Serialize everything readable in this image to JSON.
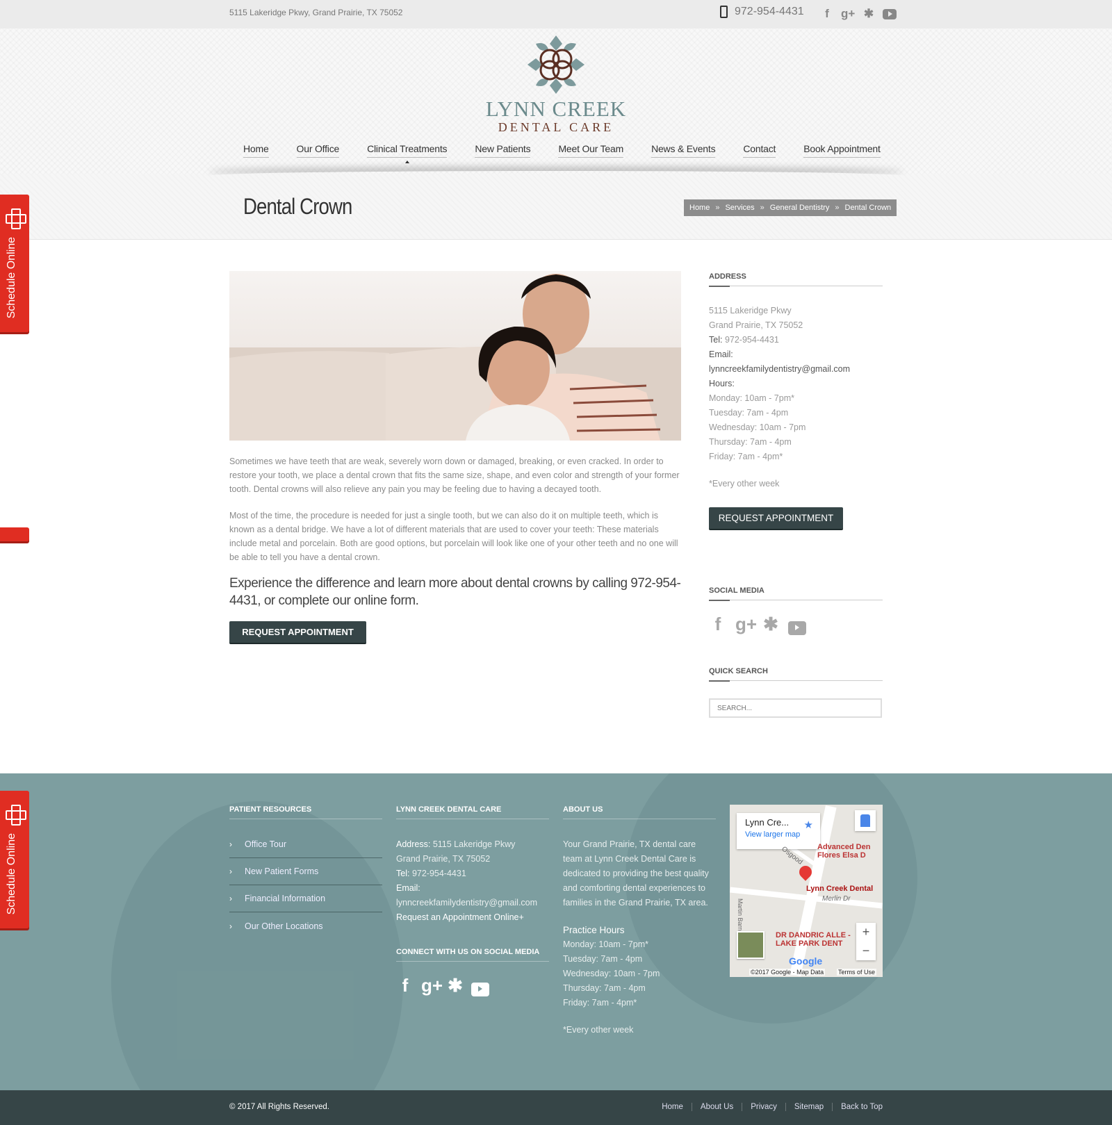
{
  "topbar": {
    "address": "5115 Lakeridge Pkwy, Grand Prairie, TX 75052",
    "phone": "972-954-4431",
    "social": [
      "facebook-icon",
      "google-plus-icon",
      "yelp-icon",
      "youtube-icon"
    ]
  },
  "logo": {
    "line1": "LYNN CREEK",
    "line2": "DENTAL CARE"
  },
  "nav": {
    "items": [
      "Home",
      "Our Office",
      "Clinical Treatments",
      "New Patients",
      "Meet Our Team",
      "News & Events",
      "Contact",
      "Book Appointment"
    ],
    "active": "Clinical Treatments"
  },
  "page": {
    "title": "Dental Crown",
    "breadcrumb": [
      "Home",
      "Services",
      "General Dentistry",
      "Dental Crown"
    ],
    "breadcrumb_sep": "»"
  },
  "schedule_tab": {
    "label": "Schedule Online"
  },
  "main": {
    "paragraph1": "Sometimes we have teeth that are weak, severely worn down or damaged, breaking, or even cracked. In order to restore your tooth, we place a dental crown that fits the same size, shape, and even color and strength of your former tooth. Dental crowns will also relieve any pain you may be feeling due to having a decayed tooth.",
    "paragraph2": "Most of the time, the procedure is needed for just a single tooth, but we can also do it on multiple teeth, which is known as a dental bridge. We have a lot of different materials that are used to cover your teeth: These materials include metal and porcelain. Both are good options, but porcelain will look like one of your other teeth and no one will be able to tell you have a dental crown.",
    "cta": "Experience the difference and learn more about dental crowns by calling 972-954-4431, or complete our online form.",
    "button": "REQUEST APPOINTMENT"
  },
  "sidebar": {
    "address_heading": "ADDRESS",
    "street": "5115 Lakeridge Pkwy",
    "city": "Grand Prairie, TX 75052",
    "tel_label": "Tel:",
    "tel": "972-954-4431",
    "email_label": "Email:",
    "email": "lynncreekfamilydentistry@gmail.com",
    "hours_label": "Hours:",
    "hours": [
      "Monday: 10am - 7pm*",
      "Tuesday: 7am - 4pm",
      "Wednesday: 10am - 7pm",
      "Thursday: 7am - 4pm",
      "Friday: 7am - 4pm*"
    ],
    "note": "*Every other week",
    "button": "REQUEST APPOINTMENT",
    "social_heading": "SOCIAL MEDIA",
    "search_heading": "QUICK SEARCH",
    "search_placeholder": "SEARCH..."
  },
  "footer": {
    "col1_heading": "PATIENT RESOURCES",
    "col1_items": [
      "Office Tour",
      "New Patient Forms",
      "Financial Information",
      "Our Other Locations"
    ],
    "col2_heading": "LYNN CREEK DENTAL CARE",
    "address_label": "Address:",
    "street": "5115 Lakeridge Pkwy",
    "city": "Grand Prairie, TX 75052",
    "tel_label": "Tel:",
    "tel": "972-954-4431",
    "email_label": "Email:",
    "email": "lynncreekfamilydentistry@gmail.com",
    "request_link": "Request an Appointment Online+",
    "social_heading": "CONNECT WITH US ON SOCIAL MEDIA",
    "col3_heading": "ABOUT US",
    "about": "Your Grand Prairie, TX dental care team at Lynn Creek Dental Care is dedicated to providing the best quality and comforting dental experiences to families in the Grand Prairie, TX area.",
    "hours_heading": "Practice Hours",
    "hours": [
      "Monday: 10am - 7pm*",
      "Tuesday: 7am - 4pm",
      "Wednesday: 10am - 7pm",
      "Thursday: 7am - 4pm",
      "Friday: 7am - 4pm*"
    ],
    "note": "*Every other week",
    "map": {
      "card_title": "Lynn Cre...",
      "card_link": "View larger map",
      "place1": "Advanced Den Flores Elsa D",
      "place2": "Lynn Creek Dental",
      "place3": "DR DANDRIC ALLE - LAKE PARK DENT",
      "street1": "Merlin Dr",
      "street2": "Martin Barnes Rd",
      "street3": "Osgood",
      "google": "Google",
      "copyright": "©2017 Google - Map Data",
      "terms": "Terms of Use"
    }
  },
  "bottom": {
    "copyright": "© 2017 All Rights Reserved.",
    "links": [
      "Home",
      "About Us",
      "Privacy",
      "Sitemap",
      "Back to Top"
    ]
  }
}
